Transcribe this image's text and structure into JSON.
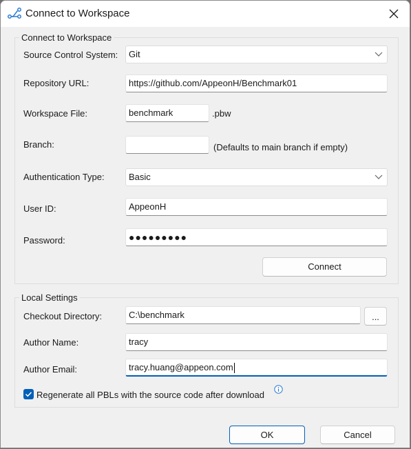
{
  "window": {
    "title": "Connect to Workspace",
    "icon": "source-control-branch-icon",
    "close_icon": "close-icon"
  },
  "connect_group": {
    "label": "Connect to Workspace",
    "source_control": {
      "label": "Source Control System:",
      "value": "Git"
    },
    "repository_url": {
      "label": "Repository URL:",
      "value": "https://github.com/AppeonH/Benchmark01"
    },
    "workspace_file": {
      "label": "Workspace File:",
      "value": "benchmark",
      "suffix": ".pbw"
    },
    "branch": {
      "label": "Branch:",
      "value": "",
      "hint": "(Defaults to main branch if empty)"
    },
    "auth_type": {
      "label": "Authentication Type:",
      "value": "Basic"
    },
    "user_id": {
      "label": "User ID:",
      "value": "AppeonH"
    },
    "password": {
      "label": "Password:",
      "masked_value": "●●●●●●●●●"
    },
    "connect_label": "Connect"
  },
  "local_group": {
    "label": "Local Settings",
    "checkout_dir": {
      "label": "Checkout Directory:",
      "value": "C:\\benchmark",
      "browse_label": "..."
    },
    "author_name": {
      "label": "Author Name:",
      "value": "tracy"
    },
    "author_email": {
      "label": "Author Email:",
      "value": "tracy.huang@appeon.com"
    },
    "regenerate": {
      "label": "Regenerate all PBLs with the source code after download",
      "checked": true,
      "info_icon": "info-icon"
    }
  },
  "footer": {
    "ok_label": "OK",
    "cancel_label": "Cancel"
  },
  "colors": {
    "accent": "#005fb8",
    "background": "#f0f0f0"
  }
}
